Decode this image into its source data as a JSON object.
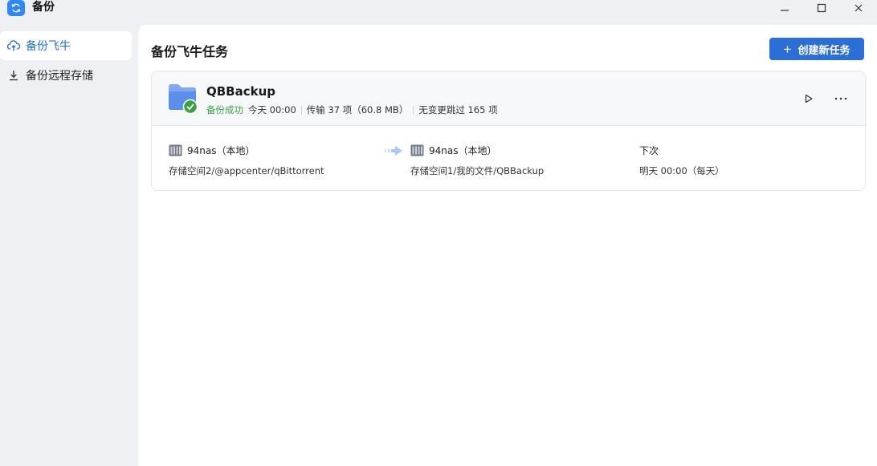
{
  "app": {
    "title": "备份",
    "icon": "sync-icon",
    "accent_color": "#2f86f6"
  },
  "window_controls": {
    "minimize": "minimize-icon",
    "maximize": "maximize-icon",
    "close": "close-icon"
  },
  "sidebar": {
    "items": [
      {
        "label": "备份飞牛",
        "icon": "cloud-upload-icon",
        "active": true
      },
      {
        "label": "备份远程存储",
        "icon": "download-icon",
        "active": false
      }
    ]
  },
  "main": {
    "title": "备份飞牛任务",
    "create_button": {
      "plus": "+",
      "label": "创建新任务"
    }
  },
  "task": {
    "name": "QBBackup",
    "status": "备份成功",
    "status_color": "#3aa24a",
    "time": "今天 00:00",
    "transfer": "传输 37 项（60.8 MB）",
    "skipped": "无变更跳过 165 项",
    "source": {
      "device": "94nas（本地）",
      "path": "存储空间2/@appcenter/qBittorrent"
    },
    "destination": {
      "device": "94nas（本地）",
      "path": "存储空间1/我的文件/QBBackup"
    },
    "next": {
      "label": "下次",
      "value": "明天 00:00（每天）"
    }
  }
}
